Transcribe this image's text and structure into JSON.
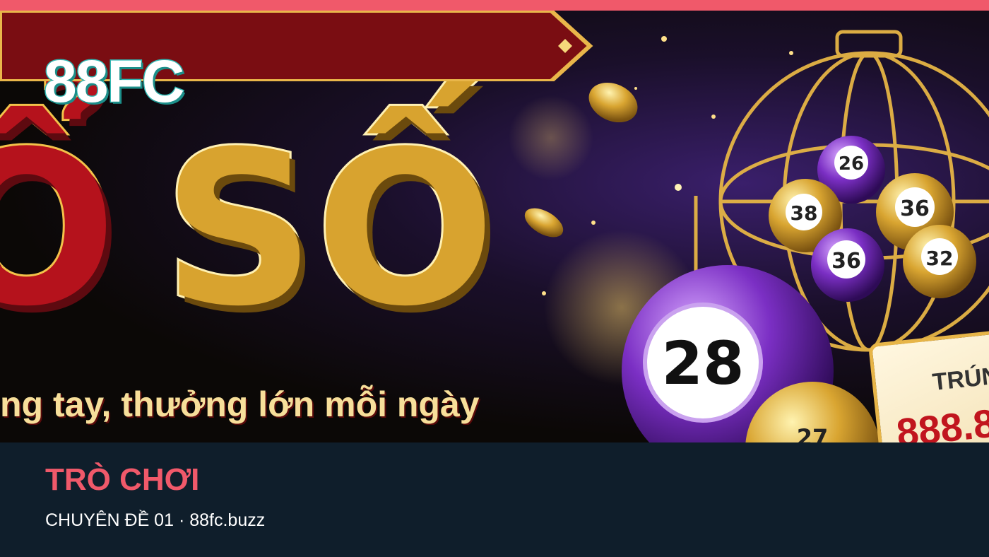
{
  "banner": {
    "logo": "88FC",
    "headline_left": "Ổ",
    "headline_right": "SỐ",
    "tagline": "ng tay, thưởng lớn mỗi ngày",
    "balls": [
      "28",
      "36",
      "38",
      "36",
      "32",
      "26",
      "27"
    ],
    "prize_label": "TRÚN",
    "prize_amount": "888.8"
  },
  "article": {
    "title": "TRÒ CHƠI",
    "subtitle": "CHUYÊN ĐỀ 01 · 88fc.buzz"
  },
  "colors": {
    "accent": "#f0596a",
    "footer_bg": "#0f1e2b",
    "logo_outline": "#2fb9b4"
  }
}
